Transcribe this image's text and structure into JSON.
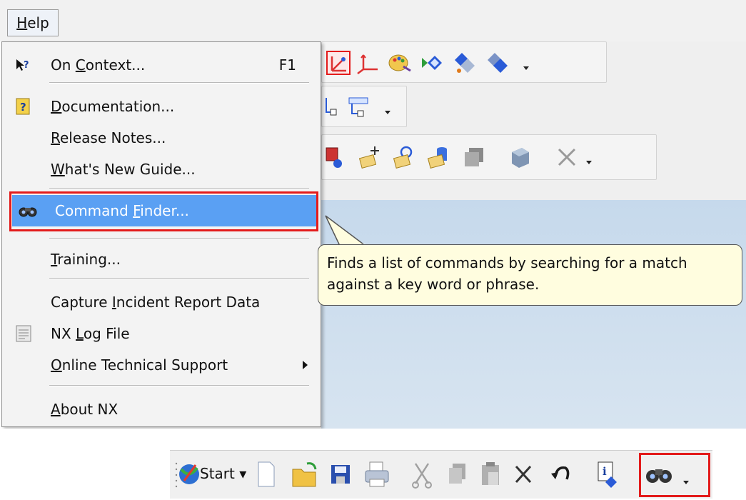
{
  "menubar": {
    "help_prefix": "H",
    "help_rest": "elp"
  },
  "menu": {
    "on_context": {
      "pre": "On ",
      "u": "C",
      "post": "ontext...",
      "shortcut": "F1",
      "icon": "pointer-help-icon"
    },
    "documentation": {
      "pre": "",
      "u": "D",
      "post": "ocumentation...",
      "icon": "help-book-icon"
    },
    "release_notes": {
      "pre": "",
      "u": "R",
      "post": "elease Notes..."
    },
    "whats_new": {
      "pre": "",
      "u": "W",
      "post": "hat's New Guide..."
    },
    "command_finder": {
      "pre": "Command ",
      "u": "F",
      "post": "inder...",
      "icon": "binoculars-icon"
    },
    "training": {
      "pre": "",
      "u": "T",
      "post": "raining..."
    },
    "capture": {
      "pre": "Capture ",
      "u": "I",
      "post": "ncident Report Data"
    },
    "log_file": {
      "pre": "NX ",
      "u": "L",
      "post": "og File",
      "icon": "log-file-icon"
    },
    "online_support": {
      "pre": "",
      "u": "O",
      "post": "nline Technical Support"
    },
    "about": {
      "pre": "",
      "u": "A",
      "post": "bout NX"
    }
  },
  "tooltip": {
    "line1": "Finds a list of commands by searching for a match",
    "line2": "against a key word or phrase."
  },
  "taskbar": {
    "start_label": "Start"
  },
  "colors": {
    "highlight": "#5aa0f3",
    "callout_border": "#e31b1b",
    "tooltip_bg": "#fffddf"
  }
}
